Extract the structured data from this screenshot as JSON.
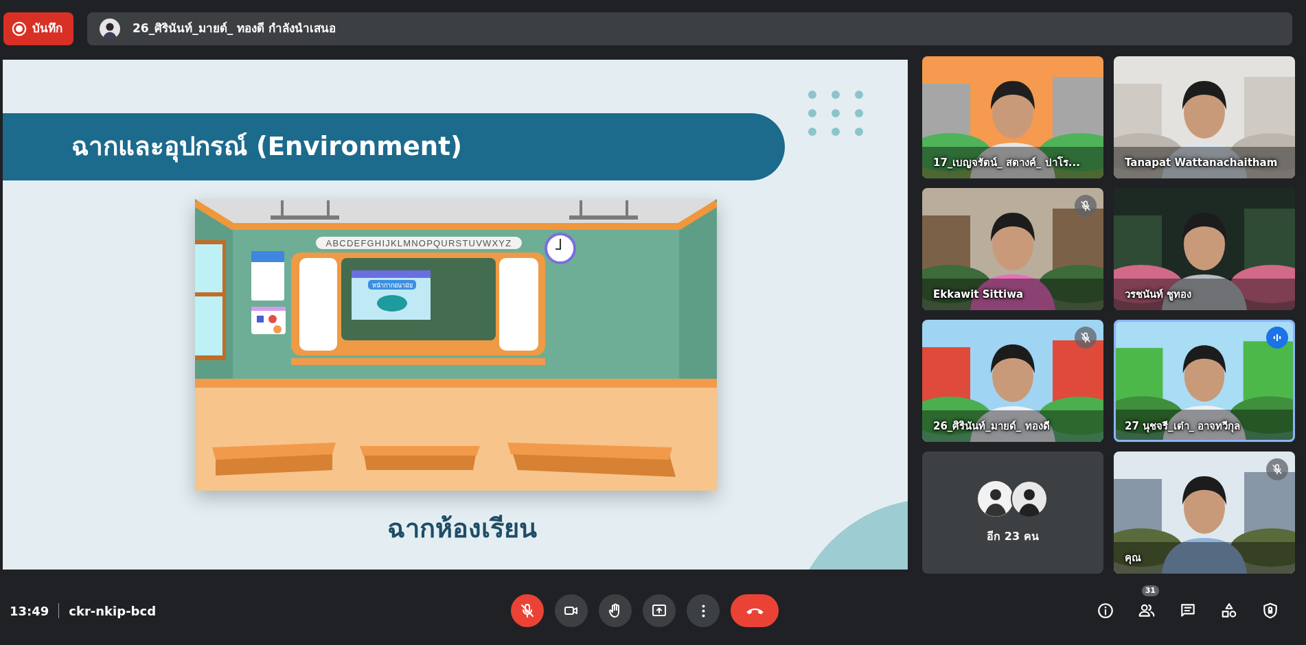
{
  "recording": {
    "label": "บันทึก"
  },
  "presenting": {
    "text": "26_ศิรินันท์_มายด์_ ทองดี กำลังนำเสนอ"
  },
  "slide": {
    "title": "ฉากและอุปกรณ์ (Environment)",
    "alphabet": "ABCDEFGHIJKLMNOPQURSTUVWXYZ",
    "board_label": "หน้ากากอนามัย",
    "caption": "ฉากห้องเรียน"
  },
  "tiles": [
    {
      "kind": "video",
      "name": "17_เบญจรัตน์_ สตางค์_ ปาโร...",
      "muted": false,
      "speaking": false
    },
    {
      "kind": "video",
      "name": "Tanapat Wattanachaitham",
      "muted": false,
      "speaking": false
    },
    {
      "kind": "video",
      "name": "Ekkawit Sittiwa",
      "muted": true,
      "speaking": false
    },
    {
      "kind": "video",
      "name": "วรชนันท์ ชูทอง",
      "muted": false,
      "speaking": false
    },
    {
      "kind": "video",
      "name": "26_ศิรินันท์_มายด์_ ทองดี",
      "muted": true,
      "speaking": false
    },
    {
      "kind": "video",
      "name": "27 นุชจรี_เต๋า_ อาจทวีกุล",
      "muted": false,
      "speaking": true
    },
    {
      "kind": "others",
      "label": "อีก 23 คน"
    },
    {
      "kind": "video",
      "name": "คุณ",
      "muted": true,
      "speaking": false
    }
  ],
  "meeting": {
    "time": "13:49",
    "code": "ckr-nkip-bcd"
  },
  "controls": [
    {
      "kind": "mic",
      "on": false
    },
    {
      "kind": "camera",
      "on": true
    },
    {
      "kind": "hand"
    },
    {
      "kind": "present"
    },
    {
      "kind": "more"
    },
    {
      "kind": "end"
    }
  ],
  "side_buttons": [
    {
      "kind": "info"
    },
    {
      "kind": "people",
      "badge": "31"
    },
    {
      "kind": "chat"
    },
    {
      "kind": "activities"
    },
    {
      "kind": "host"
    }
  ]
}
